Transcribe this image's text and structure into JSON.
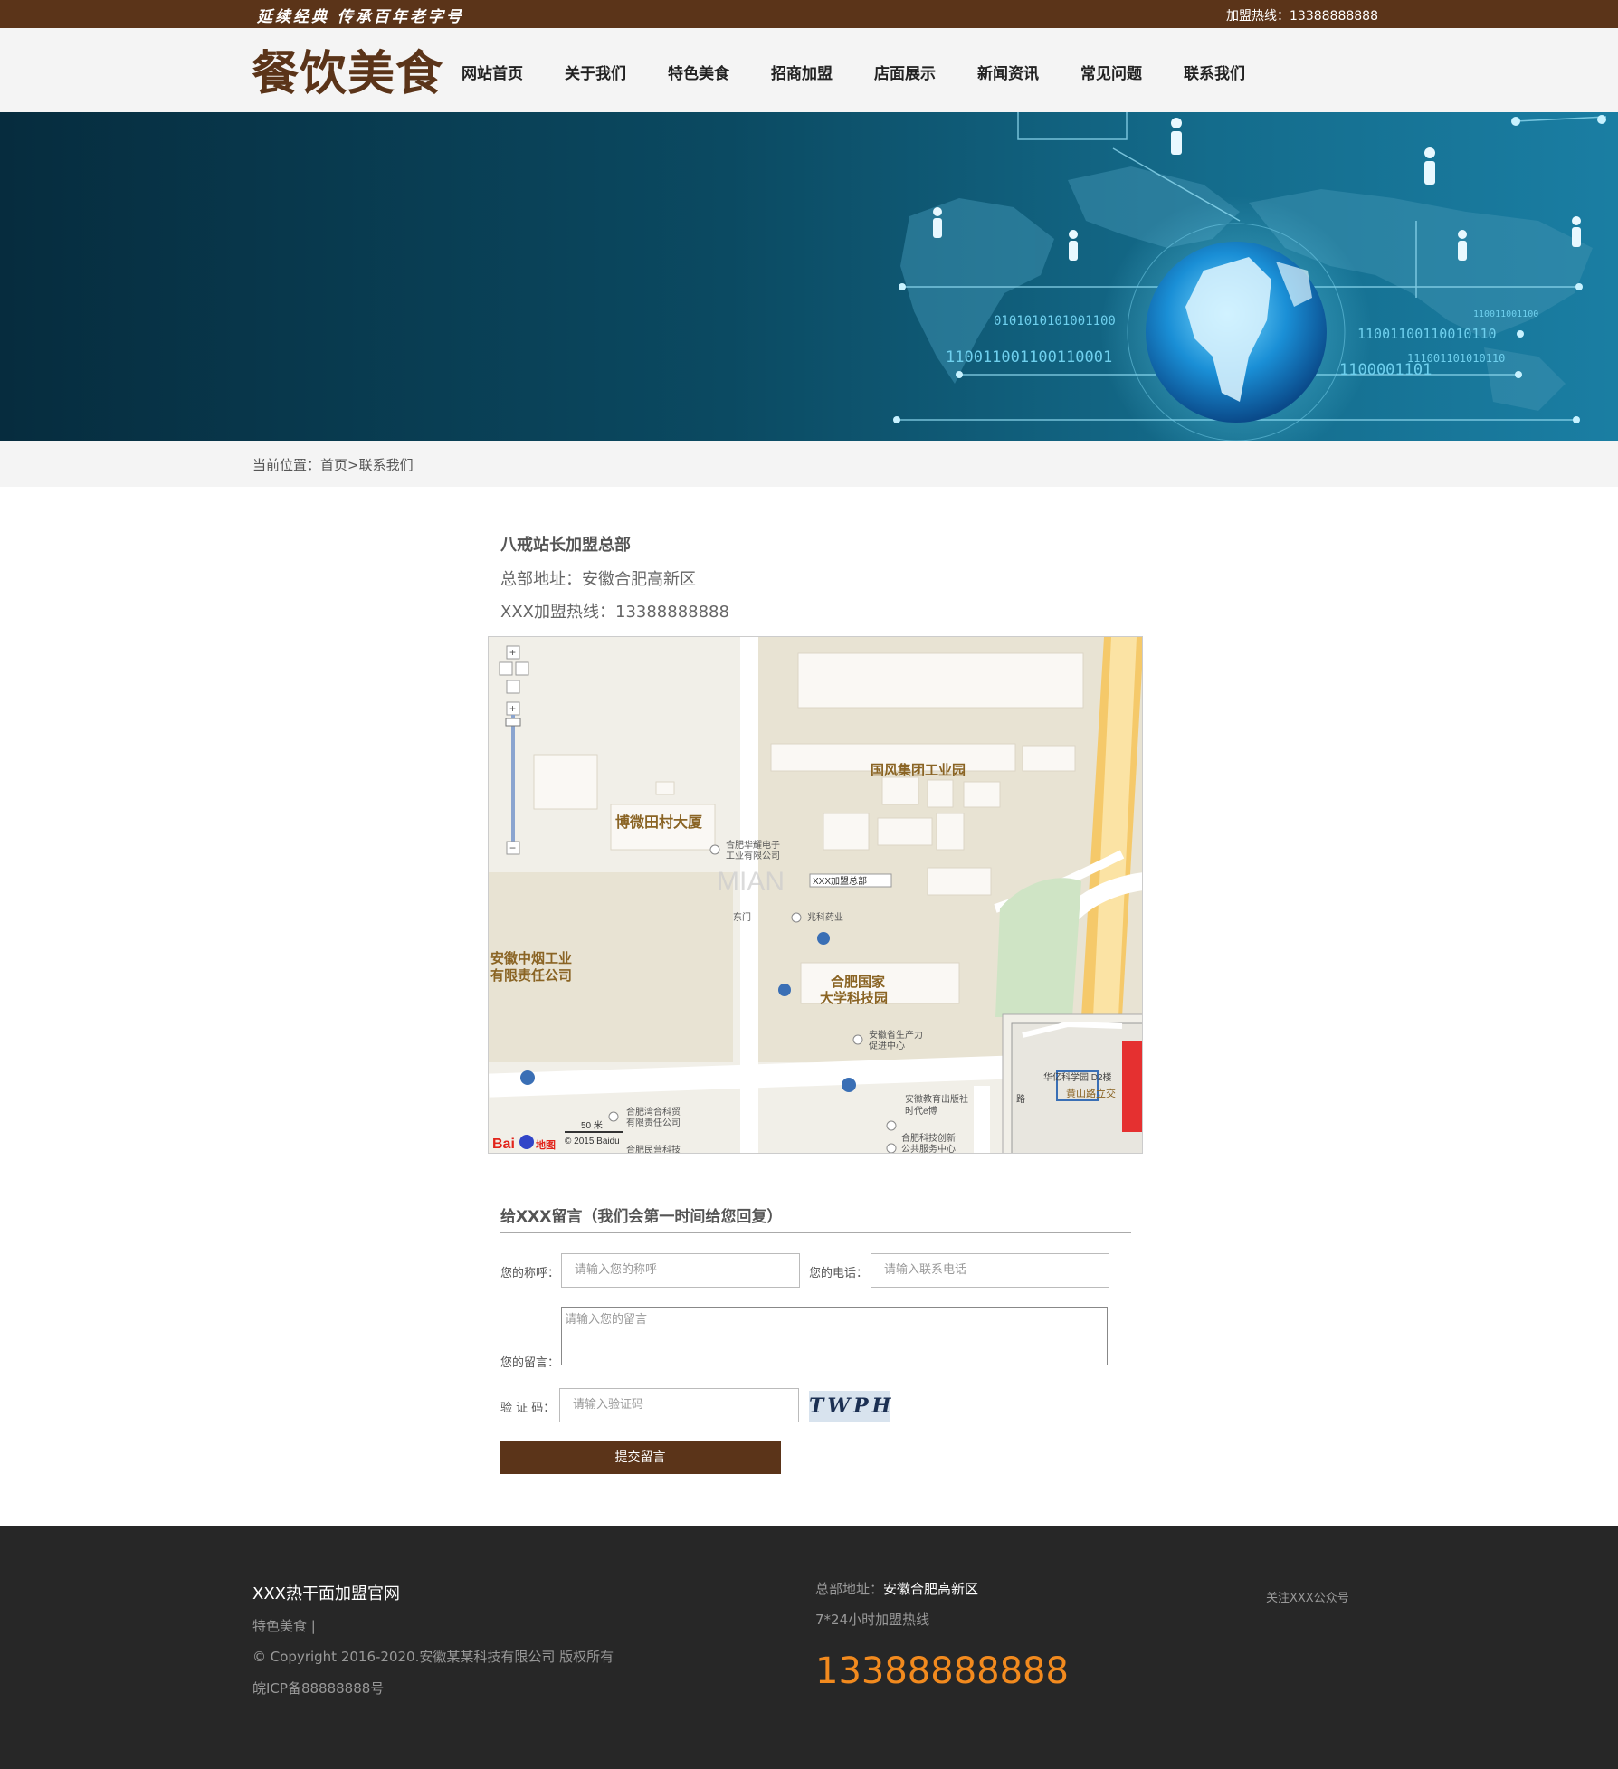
{
  "topbar": {
    "slogan": "延续经典  传承百年老字号",
    "hotline": "加盟热线：13388888888"
  },
  "header": {
    "logo": "餐饮美食",
    "nav": [
      "网站首页",
      "关于我们",
      "特色美食",
      "招商加盟",
      "店面展示",
      "新闻资讯",
      "常见问题",
      "联系我们"
    ]
  },
  "banner": {
    "binary_texts": [
      "0101010101001100",
      "110011001100110001",
      "1100001101",
      "111001101010110",
      "11001100110010110",
      "110011001100"
    ]
  },
  "breadcrumb": "当前位置：首页>联系我们",
  "contact": {
    "company": "八戒站长加盟总部",
    "address": "总部地址：安徽合肥高新区",
    "hotline": "XXX加盟热线：13388888888"
  },
  "map": {
    "labels": {
      "guofeng": "国风集团工业园",
      "bowei": "博微田村大厦",
      "huayao": "合肥华耀电子",
      "huayao2": "工业有限公司",
      "xxx_marker": "XXX加盟总部",
      "dongmen": "东门",
      "zhaoke": "兆科药业",
      "zhongyan": "安徽中烟工业",
      "zhongyan2": "有限责任公司",
      "hefei_guojia": "合肥国家",
      "daxue": "大学科技园",
      "shengchan": "安徽省生产力",
      "cujin": "促进中心",
      "wanhe": "合肥湾合科贸",
      "wanhe2": "有限责任公司",
      "jiaoyu": "安徽教育出版社",
      "shidai": "时代e博",
      "chuangxin": "合肥科技创新",
      "gonggong": "公共服务中心",
      "minying": "合肥民营科技",
      "scale": "50 米",
      "copyright": "© 2015 Baidu",
      "mini_huake": "华亿科学园 D2楼",
      "mini_huangshan": "黄山路立交",
      "mini_lu": "路",
      "watermark": "MIAN"
    }
  },
  "form": {
    "title": "给XXX留言（我们会第一时间给您回复）",
    "name_label": "您的称呼：",
    "name_placeholder": "请输入您的称呼",
    "phone_label": "您的电话：",
    "phone_placeholder": "请输入联系电话",
    "message_label": "您的留言：",
    "message_placeholder": "请输入您的留言",
    "code_label": "验 证 码：",
    "code_placeholder": "请输入验证码",
    "captcha": "TWPH",
    "submit": "提交留言"
  },
  "footer": {
    "title": "XXX热干面加盟官网",
    "link": "特色美食 |",
    "copyright": "© Copyright 2016-2020.安徽某某科技有限公司 版权所有",
    "icp": "皖ICP备88888888号",
    "address_label": "总部地址：",
    "address_value": "安徽合肥高新区",
    "hours": "7*24小时加盟热线",
    "phone": "13388888888",
    "follow": "关注XXX公众号"
  },
  "colors": {
    "brand_brown": "#5b3419",
    "footer_bg": "#272727",
    "phone_orange": "#f28a1e"
  }
}
